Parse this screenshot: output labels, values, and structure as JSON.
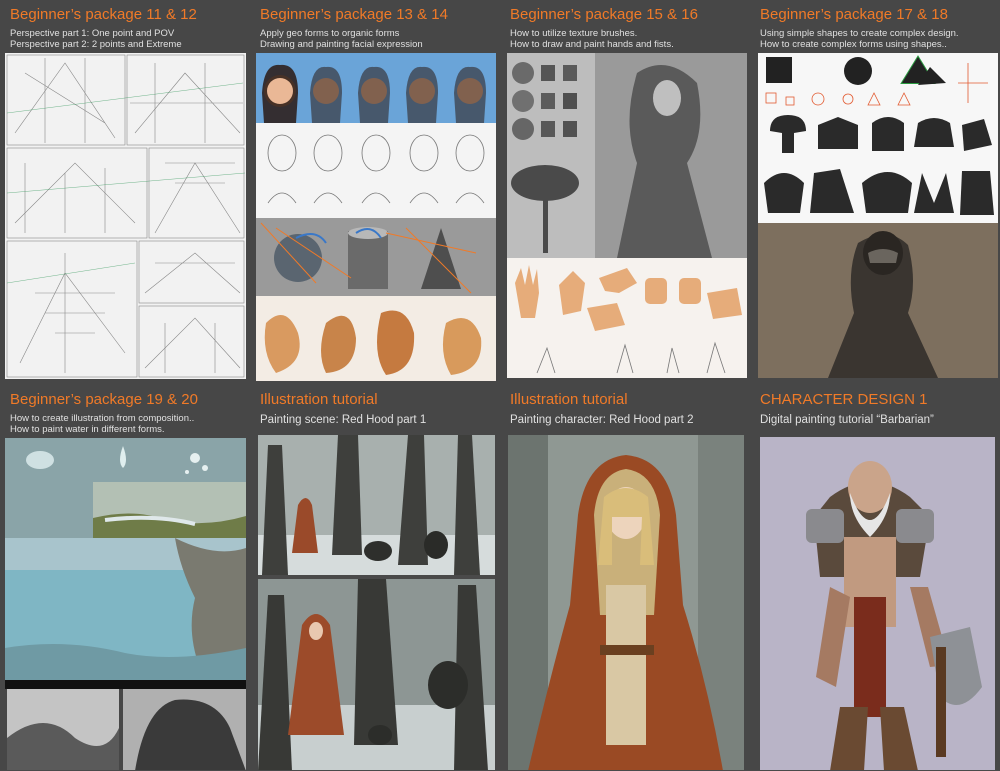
{
  "cards": [
    {
      "title": "Beginner’s package 11 & 12",
      "lines": [
        "Perspective part 1: One point and POV",
        "Perspective part 2: 2 points and Extreme"
      ]
    },
    {
      "title": "Beginner’s package 13 & 14",
      "lines": [
        "Apply geo forms to organic forms",
        "Drawing and painting facial expression"
      ]
    },
    {
      "title": "Beginner’s package 15 & 16",
      "lines": [
        "How to utilize texture brushes.",
        "How to draw and paint hands and fists."
      ]
    },
    {
      "title": "Beginner’s package 17 & 18",
      "lines": [
        "Using simple shapes to create complex design.",
        "How to create complex forms using shapes.."
      ]
    },
    {
      "title": "Beginner’s package 19 & 20",
      "lines": [
        "How to create illustration from composition..",
        "How to paint water in different forms."
      ]
    },
    {
      "title": "Illustration tutorial",
      "lines": [
        "Painting scene: Red Hood part 1"
      ]
    },
    {
      "title": "Illustration tutorial",
      "lines": [
        "Painting character: Red Hood part 2"
      ]
    },
    {
      "title": "CHARACTER DESIGN 1",
      "lines": [
        "Digital painting tutorial “Barbarian”"
      ]
    }
  ],
  "colors": {
    "accent": "#f07a28",
    "panel": "#474747",
    "text": "#e0e0e0"
  }
}
